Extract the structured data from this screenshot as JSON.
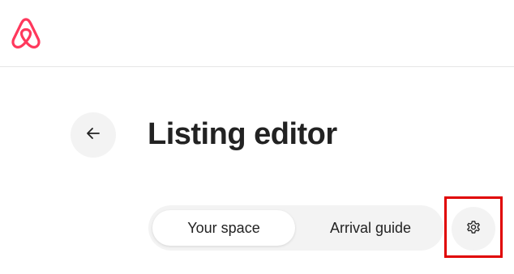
{
  "header": {
    "logo_icon": "airbnb-logo-icon",
    "brand_color": "#FF385C"
  },
  "main": {
    "back_icon": "arrow-left-icon",
    "title": "Listing editor"
  },
  "tabs": {
    "items": [
      {
        "label": "Your space",
        "active": true
      },
      {
        "label": "Arrival guide",
        "active": false
      }
    ],
    "settings_icon": "gear-icon"
  },
  "annotation": {
    "highlight_color": "#E00000"
  }
}
